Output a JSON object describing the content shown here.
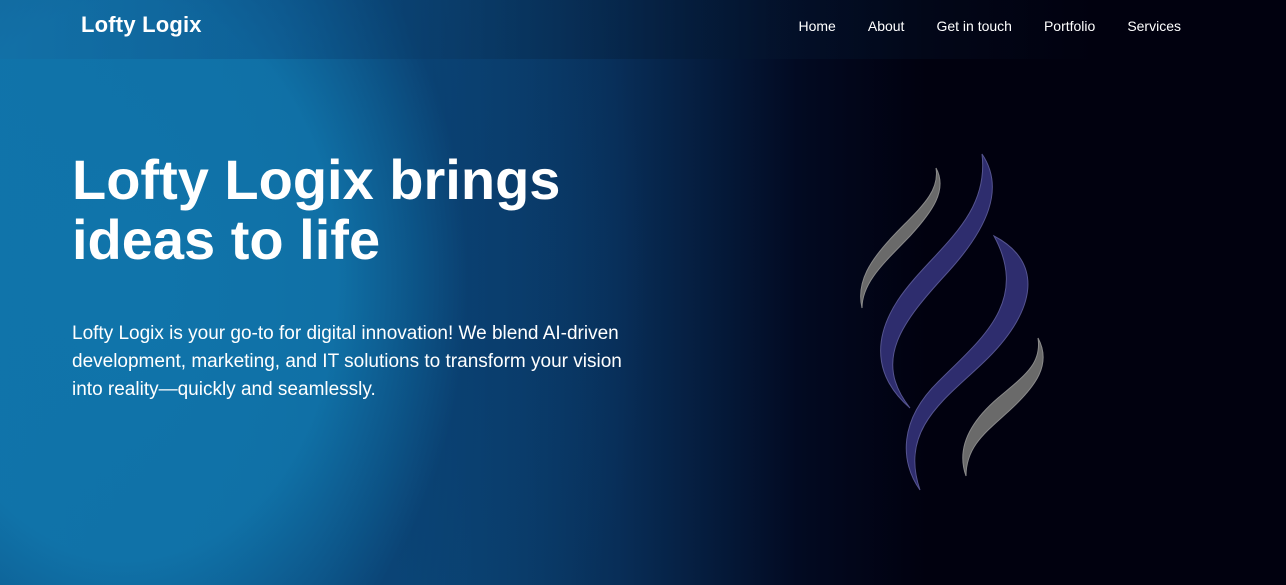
{
  "header": {
    "brand": "Lofty Logix",
    "nav": [
      {
        "label": "Home"
      },
      {
        "label": "About"
      },
      {
        "label": "Get in touch"
      },
      {
        "label": "Portfolio"
      },
      {
        "label": "Services"
      }
    ]
  },
  "hero": {
    "headline": "Lofty Logix brings ideas to life",
    "description": "Lofty Logix is your go-to for digital innovation! We blend AI-driven development, marketing, and IT solutions to transform your vision into reality—quickly and seamlessly.",
    "logo_icon": "flame-swirl-logo-icon"
  },
  "colors": {
    "accent_blue": "#1074aa",
    "dark_bg": "#01010f",
    "logo_purple": "#2e2d6e",
    "logo_gray": "#6a6a6a"
  }
}
